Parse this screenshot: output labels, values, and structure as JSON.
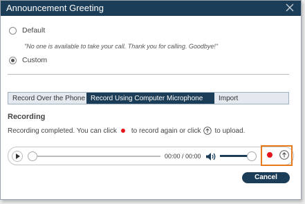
{
  "window": {
    "title": "Announcement Greeting",
    "close_icon": "close-icon"
  },
  "options": {
    "default_label": "Default",
    "default_message": "\"No one is available to take your call. Thank you for calling. Goodbye!\"",
    "custom_label": "Custom",
    "selected": "Custom"
  },
  "tabs": [
    {
      "label": "Record Over the Phone",
      "active": false
    },
    {
      "label": "Record Using Computer Microphone",
      "active": true
    },
    {
      "label": "Import",
      "active": false
    }
  ],
  "recording": {
    "section_title": "Recording",
    "info_part1": "Recording completed. You can click",
    "info_part2": "to record again or click",
    "info_part3": "to upload."
  },
  "player": {
    "time": "00:00 / 00:00",
    "progress": 0,
    "volume": 1.0
  },
  "footer": {
    "cancel_label": "Cancel"
  },
  "colors": {
    "header": "#1c3d57",
    "record": "#e8141c",
    "highlight": "#e87a1b"
  }
}
